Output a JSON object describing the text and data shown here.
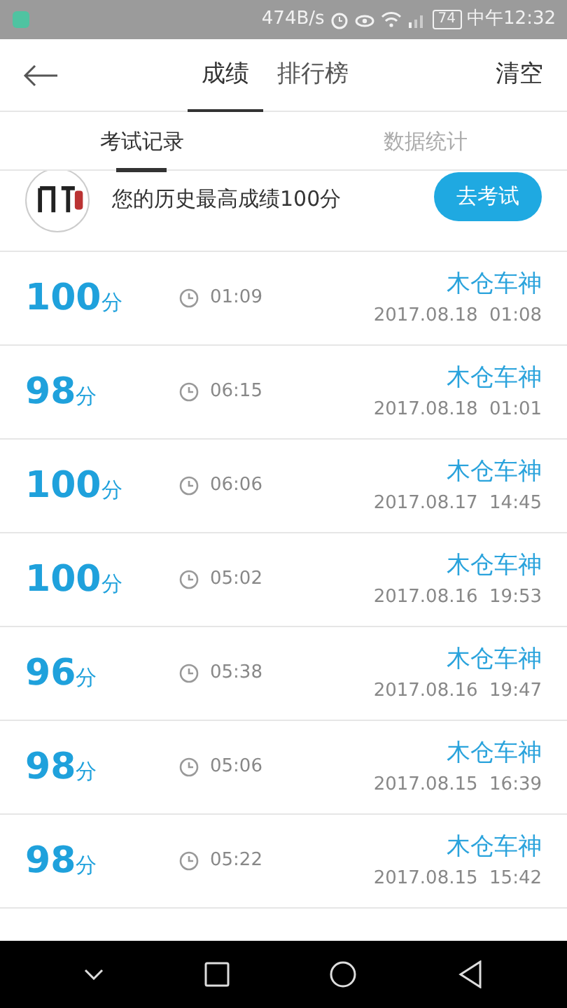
{
  "status_bar": {
    "speed": "474B/s",
    "battery": "74",
    "time": "中午12:32"
  },
  "header": {
    "tabs": [
      {
        "label": "成绩",
        "selected": true
      },
      {
        "label": "排行榜",
        "selected": false
      }
    ],
    "action": "清空"
  },
  "sub_tabs": [
    {
      "label": "考试记录",
      "selected": true
    },
    {
      "label": "数据统计",
      "selected": false
    }
  ],
  "banner": {
    "text": "您的历史最高成绩100分",
    "button": "去考试"
  },
  "records": [
    {
      "score": "100",
      "unit": "分",
      "duration": "01:09",
      "name": "木仓车神",
      "date": "2017.08.18  01:08"
    },
    {
      "score": "98",
      "unit": "分",
      "duration": "06:15",
      "name": "木仓车神",
      "date": "2017.08.18  01:01"
    },
    {
      "score": "100",
      "unit": "分",
      "duration": "06:06",
      "name": "木仓车神",
      "date": "2017.08.17  14:45"
    },
    {
      "score": "100",
      "unit": "分",
      "duration": "05:02",
      "name": "木仓车神",
      "date": "2017.08.16  19:53"
    },
    {
      "score": "96",
      "unit": "分",
      "duration": "05:38",
      "name": "木仓车神",
      "date": "2017.08.16  19:47"
    },
    {
      "score": "98",
      "unit": "分",
      "duration": "05:06",
      "name": "木仓车神",
      "date": "2017.08.15  16:39"
    },
    {
      "score": "98",
      "unit": "分",
      "duration": "05:22",
      "name": "木仓车神",
      "date": "2017.08.15  15:42"
    }
  ]
}
